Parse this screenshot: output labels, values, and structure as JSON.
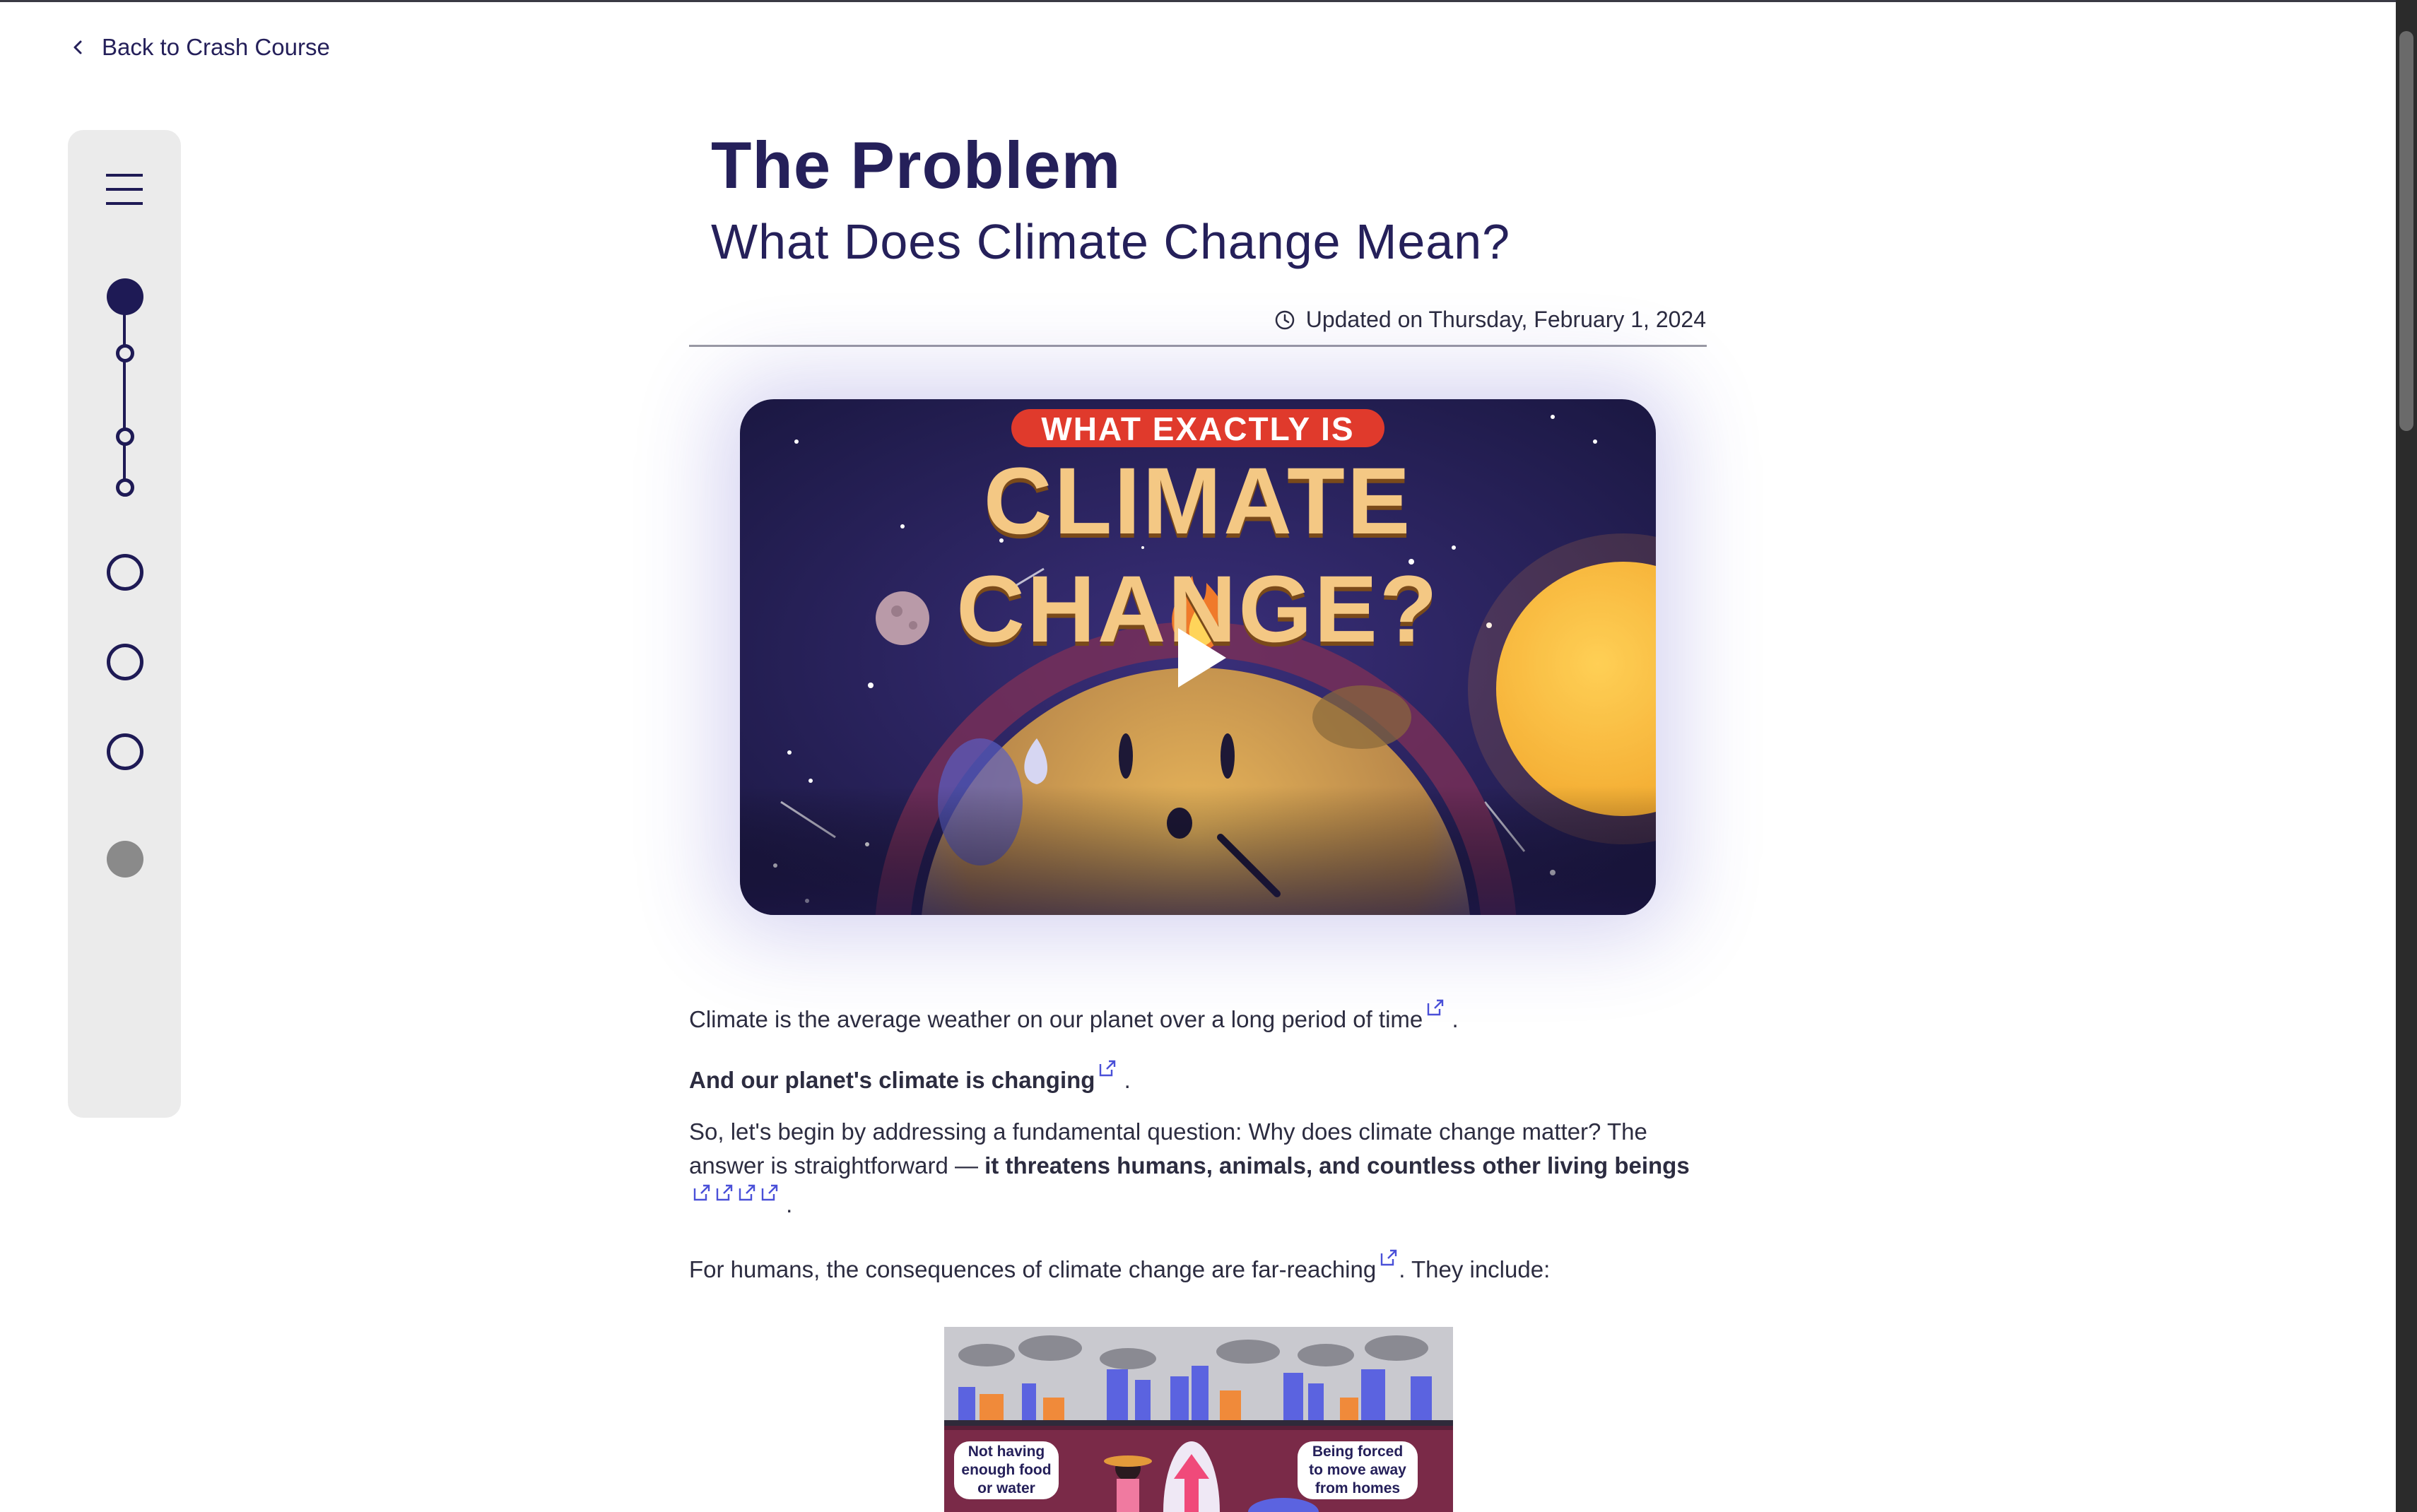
{
  "nav": {
    "back_label": "Back to Crash Course"
  },
  "header": {
    "title": "The Problem",
    "subtitle": "What Does Climate Change Mean?",
    "updated": "Updated on Thursday, February 1, 2024"
  },
  "video": {
    "thumb_line1": "WHAT EXACTLY IS",
    "thumb_line2": "CLIMATE CHANGE?"
  },
  "body": {
    "p1": "Climate is the average weather on our planet over a long period of time",
    "p1_end": ".",
    "p2": "And our planet's climate is changing",
    "p2_end": ".",
    "p3_a": "So, let's begin by addressing a fundamental question: Why does climate change matter? The answer is straightforward — ",
    "p3_b": "it threatens humans, animals, and countless other living beings",
    "p3_end": ".",
    "p4_a": "For humans, the consequences of climate change are far-reaching",
    "p4_b": ". They include:"
  },
  "illustration": {
    "bubble_left": "Not having\nenough food\nor water",
    "bubble_right": "Being forced\nto move away\nfrom homes"
  },
  "colors": {
    "brand": "#25205a",
    "sidebar_bg": "#ebebeb",
    "link_icon": "#4a50d8"
  }
}
